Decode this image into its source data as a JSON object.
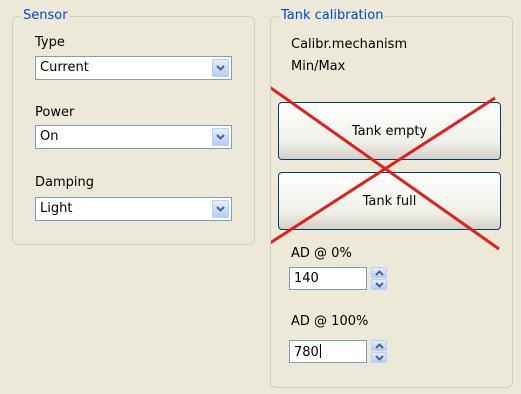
{
  "sensor": {
    "title": "Sensor",
    "type": {
      "label": "Type",
      "value": "Current"
    },
    "power": {
      "label": "Power",
      "value": "On"
    },
    "damping": {
      "label": "Damping",
      "value": "Light"
    }
  },
  "tank_calibration": {
    "title": "Tank calibration",
    "mechanism_label": "Calibr.mechanism",
    "mechanism_value": "Min/Max",
    "tank_empty_label": "Tank empty",
    "tank_full_label": "Tank full",
    "ad0": {
      "label": "AD @ 0%",
      "value": "140"
    },
    "ad100": {
      "label": "AD @ 100%",
      "value": "780"
    }
  },
  "colors": {
    "background": "#ECE9D8",
    "group_title": "#0046D5",
    "cross": "#E0201A"
  }
}
